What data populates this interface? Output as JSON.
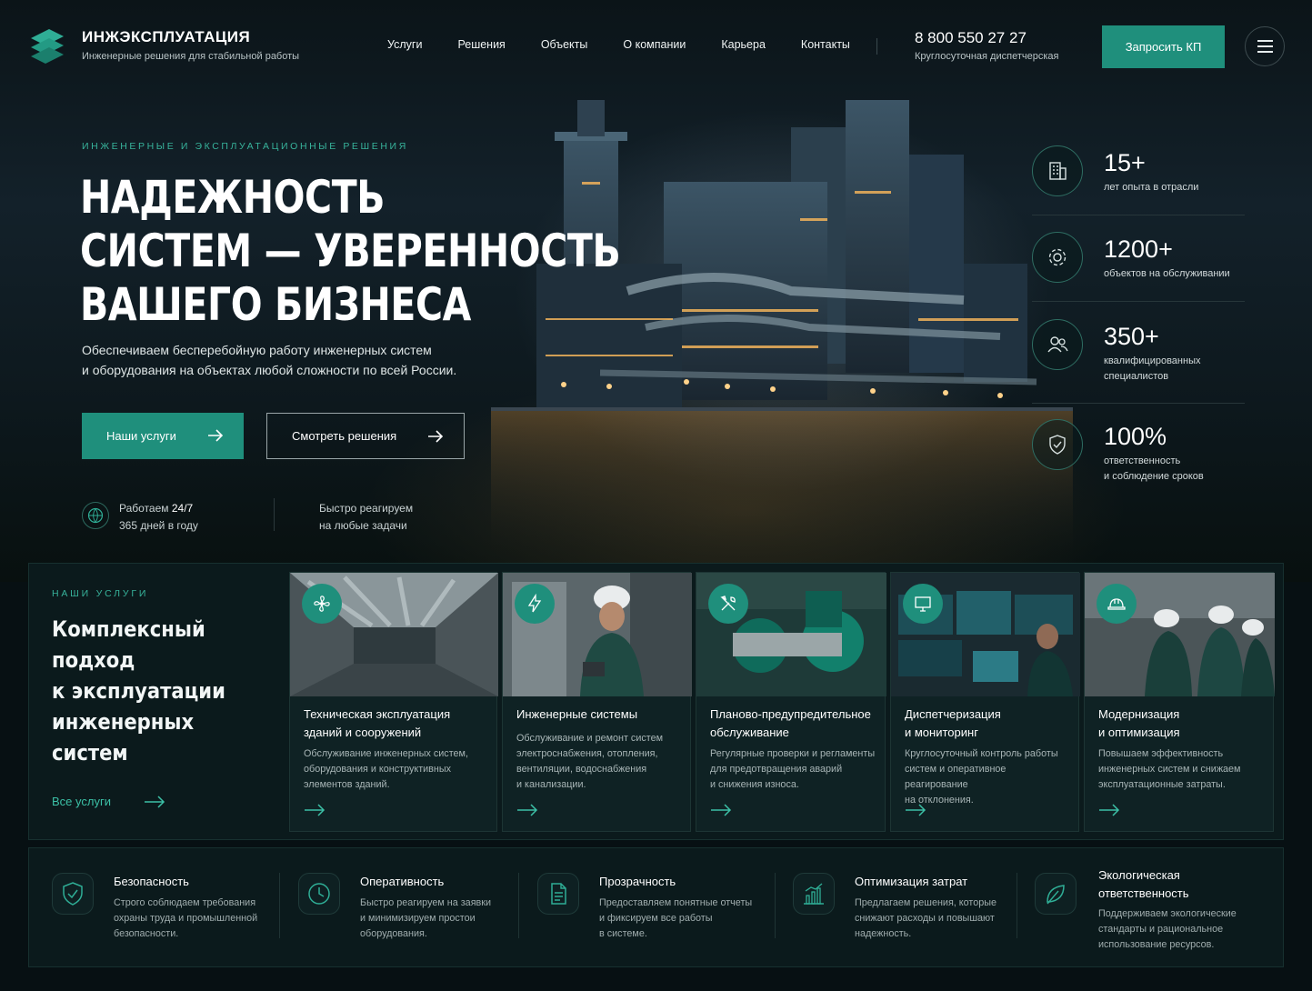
{
  "brand": {
    "name": "ИНЖЭКСПЛУАТАЦИЯ",
    "tagline": "Инженерные решения для стабильной работы",
    "accent_color": "#1f8f7c"
  },
  "nav": [
    "Услуги",
    "Решения",
    "Объекты",
    "О компании",
    "Карьера",
    "Контакты"
  ],
  "contact": {
    "phone": "8 800 550 27 27",
    "note": "Круглосуточная диспетчерская",
    "cta": "Запросить КП"
  },
  "hero": {
    "eyebrow": "ИНЖЕНЕРНЫЕ И ЭКСПЛУАТАЦИОННЫЕ РЕШЕНИЯ",
    "title": [
      "НАДЕЖНОСТЬ",
      "СИСТЕМ — УВЕРЕННОСТЬ",
      "ВАШЕГО БИЗНЕСА"
    ],
    "description": [
      "Обеспечиваем бесперебойную работу инженерных систем",
      "и оборудования на объектах любой сложности по всей России."
    ],
    "primary_button": "Наши услуги",
    "secondary_button": "Смотреть решения",
    "availability": {
      "lead": "Работаем",
      "value": "24/7",
      "days": "365 дней в году"
    },
    "response": [
      "Быстро реагируем",
      "на любые задачи"
    ]
  },
  "stats": [
    {
      "icon": "building-icon",
      "value": "15+",
      "label": [
        "лет опыта в отрасли"
      ]
    },
    {
      "icon": "gear-icon",
      "value": "1200+",
      "label": [
        "объектов на обслуживании"
      ]
    },
    {
      "icon": "users-icon",
      "value": "350+",
      "label": [
        "квалифицированных",
        "специалистов"
      ]
    },
    {
      "icon": "shield-check-icon",
      "value": "100%",
      "label": [
        "ответственность",
        "и соблюдение сроков"
      ]
    }
  ],
  "services": {
    "eyebrow": "НАШИ УСЛУГИ",
    "title": [
      "Комплексный подход",
      "к эксплуатации",
      "инженерных систем"
    ],
    "all_link": "Все услуги",
    "cards": [
      {
        "icon": "fan-icon",
        "title": [
          "Техническая эксплуатация",
          "зданий и сооружений"
        ],
        "desc": [
          "Обслуживание инженерных систем,",
          "оборудования и конструктивных",
          "элементов зданий."
        ]
      },
      {
        "icon": "lightning-icon",
        "title": [
          "Инженерные системы"
        ],
        "desc": [
          "Обслуживание и ремонт систем",
          "электроснабжения, отопления,",
          "вентиляции, водоснабжения",
          "и канализации."
        ]
      },
      {
        "icon": "tools-icon",
        "title": [
          "Планово-предупредительное",
          "обслуживание"
        ],
        "desc": [
          "Регулярные проверки и регламенты",
          "для предотвращения аварий",
          "и снижения износа."
        ]
      },
      {
        "icon": "monitor-icon",
        "title": [
          "Диспетчеризация",
          "и мониторинг"
        ],
        "desc": [
          "Круглосуточный контроль работы",
          "систем и оперативное реагирование",
          "на отклонения."
        ]
      },
      {
        "icon": "hardhat-icon",
        "title": [
          "Модернизация",
          "и оптимизация"
        ],
        "desc": [
          "Повышаем эффективность",
          "инженерных систем и снижаем",
          "эксплуатационные затраты."
        ]
      }
    ]
  },
  "features": [
    {
      "icon": "shield-check-icon",
      "title": [
        "Безопасность"
      ],
      "desc": [
        "Строго соблюдаем требования",
        "охраны труда и промышленной",
        "безопасности."
      ]
    },
    {
      "icon": "clock-icon",
      "title": [
        "Оперативность"
      ],
      "desc": [
        "Быстро реагируем на заявки",
        "и минимизируем простои",
        "оборудования."
      ]
    },
    {
      "icon": "document-icon",
      "title": [
        "Прозрачность"
      ],
      "desc": [
        "Предоставляем понятные отчеты",
        "и фиксируем все работы",
        "в системе."
      ]
    },
    {
      "icon": "chart-icon",
      "title": [
        "Оптимизация затрат"
      ],
      "desc": [
        "Предлагаем решения, которые",
        "снижают расходы и повышают",
        "надежность."
      ]
    },
    {
      "icon": "leaf-icon",
      "title": [
        "Экологическая",
        "ответственность"
      ],
      "desc": [
        "Поддерживаем экологические",
        "стандарты и рациональное",
        "использование ресурсов."
      ]
    }
  ]
}
